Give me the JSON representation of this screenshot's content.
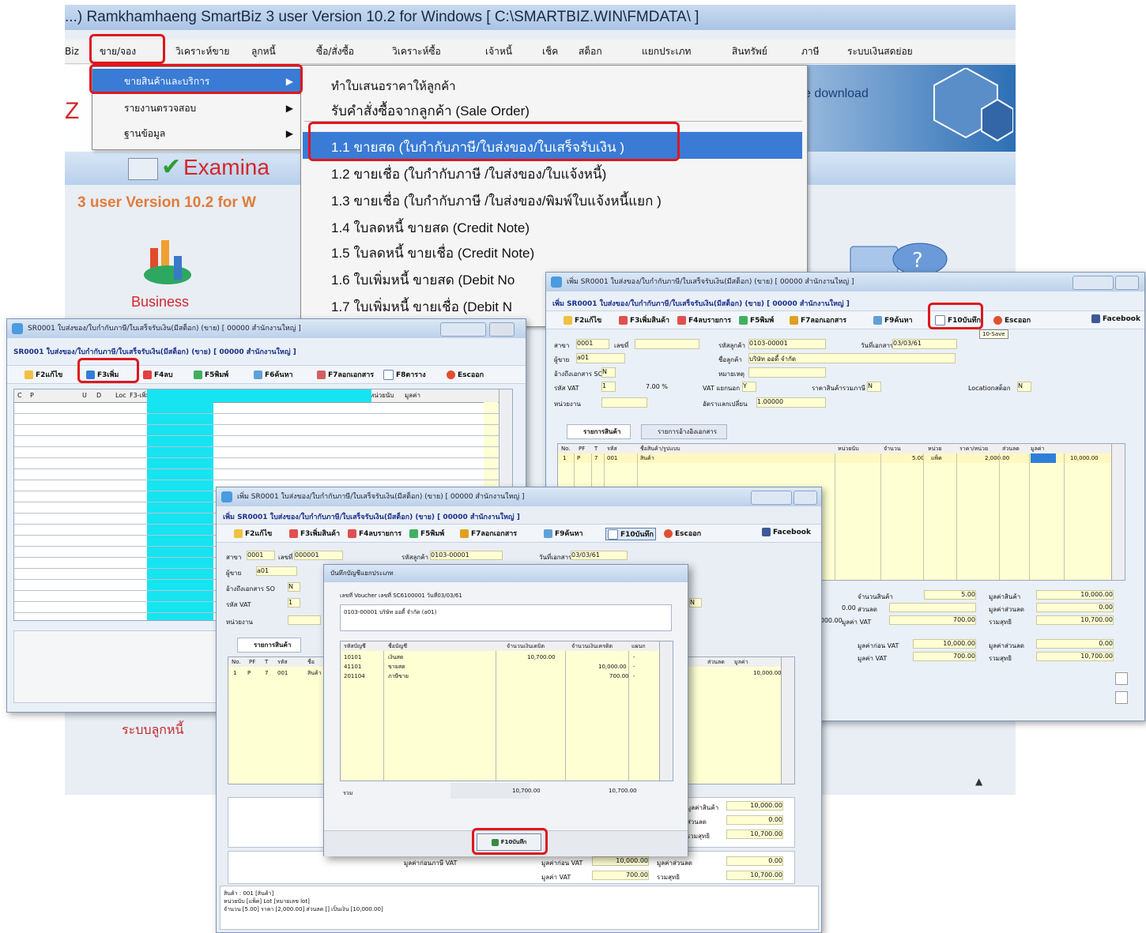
{
  "main_window": {
    "title": "...) Ramkhamhaeng SmartBiz 3 user Version 10.2 for Windows [ C:\\SMARTBIZ.WIN\\FMDATA\\ ]",
    "menu": [
      "Biz",
      "ขาย/จอง",
      "วิเคราะห์ขาย",
      "ลูกหนี้",
      "ซื้อ/สั่งซื้อ",
      "วิเคราะห์ซื้อ",
      "เจ้าหนี้",
      "เช็ค",
      "สต็อก",
      "แยกประเภท",
      "สินทรัพย์",
      "ภาษี",
      "ระบบเงินสดย่อย"
    ],
    "dropdown": [
      "ขายสินค้าและบริการ",
      "รายงานตรวจสอบ",
      "ฐานข้อมูล"
    ],
    "submenu": [
      "ทำใบเสนอราคาให้ลูกค้า",
      "รับคำสั่งซื้อจากลูกค้า (Sale Order)",
      "1.1 ขายสด (ใบกำกับภาษี/ใบส่งของ/ใบเสร็จรับเงิน )",
      "1.2 ขายเชื่อ (ใบกำกับภาษี /ใบส่งของ/ใบแจ้งหนี้)",
      "1.3 ขายเชื่อ (ใบกำกับภาษี /ใบส่งของ/พิมพ์ใบแจ้งหนี้แยก )",
      "1.4 ใบลดหนี้ ขายสด (Credit Note)",
      "1.5 ใบลดหนี้ ขายเชื่อ (Credit Note)",
      "1.6 ใบเพิ่มหนี้ ขายสด (Debit No",
      "1.7 ใบเพิ่มหนี้ ขายเชื่อ (Debit N"
    ],
    "banner_left": "Z",
    "banner_right": "e download",
    "examination": "Examina",
    "version_text": "3 user Version 10.2 for W",
    "business_label": "Business",
    "ar_label": "ระบบลูกหนี้"
  },
  "win_list": {
    "title": "SR0001 ใบส่งของ/ใบกำกับภาษี/ใบเสร็จรับเงิน(มีสต็อก) (ขาย) [ 00000 สำนักงานใหญ่ ]",
    "subtitle": "SR0001 ใบส่งของ/ใบกำกับภาษี/ใบเสร็จรับเงิน(มีสต็อก) (ขาย) [ 00000 สำนักงานใหญ่ ]",
    "toolbar": [
      "F2แก้ไข",
      "F3เพิ่ม",
      "F4ลบ",
      "F5พิมพ์",
      "F6ค้นหา",
      "F7ลอกเอกสาร",
      "F8ตาราง",
      "Escออก"
    ],
    "columns": [
      "C",
      "P",
      "",
      "U",
      "D",
      "Loc",
      "F3-เพิ่ม",
      "",
      "",
      "",
      "หน่วยนับ",
      "มูลค่า"
    ]
  },
  "win_edit": {
    "title": "เพิ่ม SR0001 ใบส่งของ/ใบกำกับภาษี/ใบเสร็จรับเงิน(มีสต็อก) (ขาย) [ 00000 สำนักงานใหญ่ ]",
    "subtitle": "เพิ่ม SR0001 ใบส่งของ/ใบกำกับภาษี/ใบเสร็จรับเงิน(มีสต็อก) (ขาย) [ 00000 สำนักงานใหญ่ ]",
    "toolbar": [
      "F2แก้ไข",
      "F3เพิ่มสินค้า",
      "F4ลบรายการ",
      "F5พิมพ์",
      "F7ลอกเอกสาร",
      "F9ค้นหา",
      "F10บันทึก",
      "Escออก",
      "Facebook"
    ],
    "tooltip": "10-Save",
    "fields": {
      "lbl_branch": "สาขา",
      "branch": "0001",
      "lbl_docno": "เลขที่",
      "lbl_customer": "รหัสลูกค้า",
      "customer": "0103-00001",
      "lbl_date": "วันที่เอกสาร",
      "date": "03/03/61",
      "lbl_salesman": "ผู้ขาย",
      "salesman": "a01",
      "lbl_custname": "ชื่อลูกค้า",
      "custname": "บริษัท ออดี้ จำกัด",
      "lbl_ref": "อ้างถึงเอกสาร SO",
      "ref": "N",
      "lbl_note": "หมายเหตุ",
      "lbl_vat": "รหัส VAT",
      "vat_code": "1",
      "vat_rate": "7.00 %",
      "lbl_vattype": "VAT แยกนอก",
      "vattype": "Y",
      "lbl_pricetype": "ราคาสินค้ารวมภาษี",
      "pricetype": "N",
      "lbl_stock": "Locationสต็อก",
      "stock": "N",
      "lbl_project": "หน่วยงาน",
      "lbl_rate": "อัตราแลกเปลี่ยน",
      "rate": "1.00000"
    },
    "tabs": [
      "รายการสินค้า",
      "รายการอ้างอิงเอกสาร"
    ],
    "grid_columns": [
      "No.",
      "PF",
      "T",
      "รหัส",
      "ชื่อสินค้า/รูปแบบ",
      "หน่วยนับ",
      "จำนวน",
      "หน่วย",
      "ราคา/หน่วย",
      "ส่วนลด",
      "มูลค่า"
    ],
    "grid_row": {
      "no": "1",
      "pf": "P",
      "t": "7",
      "code": "001",
      "name": "สินค้า",
      "qty": "5.00",
      "unit": "แพ็ค",
      "price": "2,000.00",
      "amount": "10,000.00"
    },
    "summary": {
      "r1": [
        "จำนวนสินค้า",
        "5.00",
        "มูลค่าสินค้า",
        "10,000.00"
      ],
      "r2": [
        "0.00",
        "ส่วนลด",
        "มูลค่าส่วนลด",
        "0.00"
      ],
      "r3": [
        "10,000.00",
        "มูลค่า VAT",
        "700.00",
        "รวมสุทธิ",
        "10,700.00"
      ],
      "r4": [
        "มูลค่าก่อน VAT",
        "10,000.00",
        "มูลค่าส่วนลด",
        "0.00"
      ],
      "r5": [
        "มูลค่า VAT",
        "700.00",
        "รวมสุทธิ",
        "10,700.00"
      ]
    }
  },
  "win_front": {
    "title": "เพิ่ม SR0001 ใบส่งของ/ใบกำกับภาษี/ใบเสร็จรับเงิน(มีสต็อก) (ขาย) [ 00000 สำนักงานใหญ่ ]",
    "subtitle": "เพิ่ม SR0001 ใบส่งของ/ใบกำกับภาษี/ใบเสร็จรับเงิน(มีสต็อก) (ขาย) [ 00000 สำนักงานใหญ่ ]",
    "toolbar": [
      "F2แก้ไข",
      "F3เพิ่มสินค้า",
      "F4ลบรายการ",
      "F5พิมพ์",
      "F7ลอกเอกสาร",
      "F9ค้นหา",
      "F10บันทึก",
      "Escออก",
      "Facebook"
    ],
    "fields": {
      "branch": "0001",
      "docno": "000001",
      "customer": "0103-00001",
      "date": "03/03/61",
      "salesman": "a01",
      "ref": "N",
      "vat_code": "1",
      "vattype": "N"
    },
    "grid_header": [
      "No.",
      "PF",
      "T",
      "รหัส",
      "ชื่อ",
      "ส่วนลด",
      "มูลค่า"
    ],
    "grid_row": [
      "1",
      "P",
      "7",
      "001",
      "สินค้า",
      "10,000.00"
    ],
    "summary": [
      [
        "มูลค่าสินค้า",
        "10,000.00"
      ],
      [
        "ส่วนลด",
        "0.00"
      ],
      [
        "รวมสุทธิ",
        "10,700.00"
      ]
    ],
    "summary2": [
      [
        "มูลค่าก่อนภาษี VAT",
        "10,000.00",
        "มูลค่าส่วนลด",
        "0.00"
      ],
      [
        "มูลค่า VAT",
        "700.00",
        "รวมสุทธิ",
        "10,700.00"
      ]
    ],
    "footer": [
      "สินค้า : 001 [สินค้า]",
      "หน่วยนับ [แพ็ค] Lot [หมายเลข lot]",
      "จำนวน [5.00] ราคา [2,000.00] ส่วนลด [] เป็นเงิน [10,000.00]"
    ]
  },
  "dialog": {
    "title": "บันทึกบัญชีแยกประเภท",
    "voucher": "เลขที่ Voucher เลขที่ SC6100001 วันที่03/03/61",
    "desc": "0103-00001 บริษัท ออดี้ จำกัด (a01)",
    "columns": [
      "รหัสบัญชี",
      "ชื่อบัญชี",
      "จำนวนเงินเดบิต",
      "จำนวนเงินเครดิต",
      "แผนก"
    ],
    "rows": [
      [
        "10101",
        "เงินสด",
        "10,700.00",
        "",
        "-"
      ],
      [
        "41101",
        "ขายสด",
        "",
        "10,000.00",
        "-"
      ],
      [
        "201104",
        "ภาษีขาย",
        "",
        "700.00",
        "-"
      ]
    ],
    "total_label": "รวม",
    "total_debit": "10,700.00",
    "total_credit": "10,700.00",
    "ok_button": "F10บันทึก"
  },
  "colors": {
    "highlight": "#e0161e",
    "title_text": "#1a2f8a",
    "menu_select": "#3a7bd5",
    "cyan": "#16e4f0",
    "field": "#ffffd4"
  }
}
